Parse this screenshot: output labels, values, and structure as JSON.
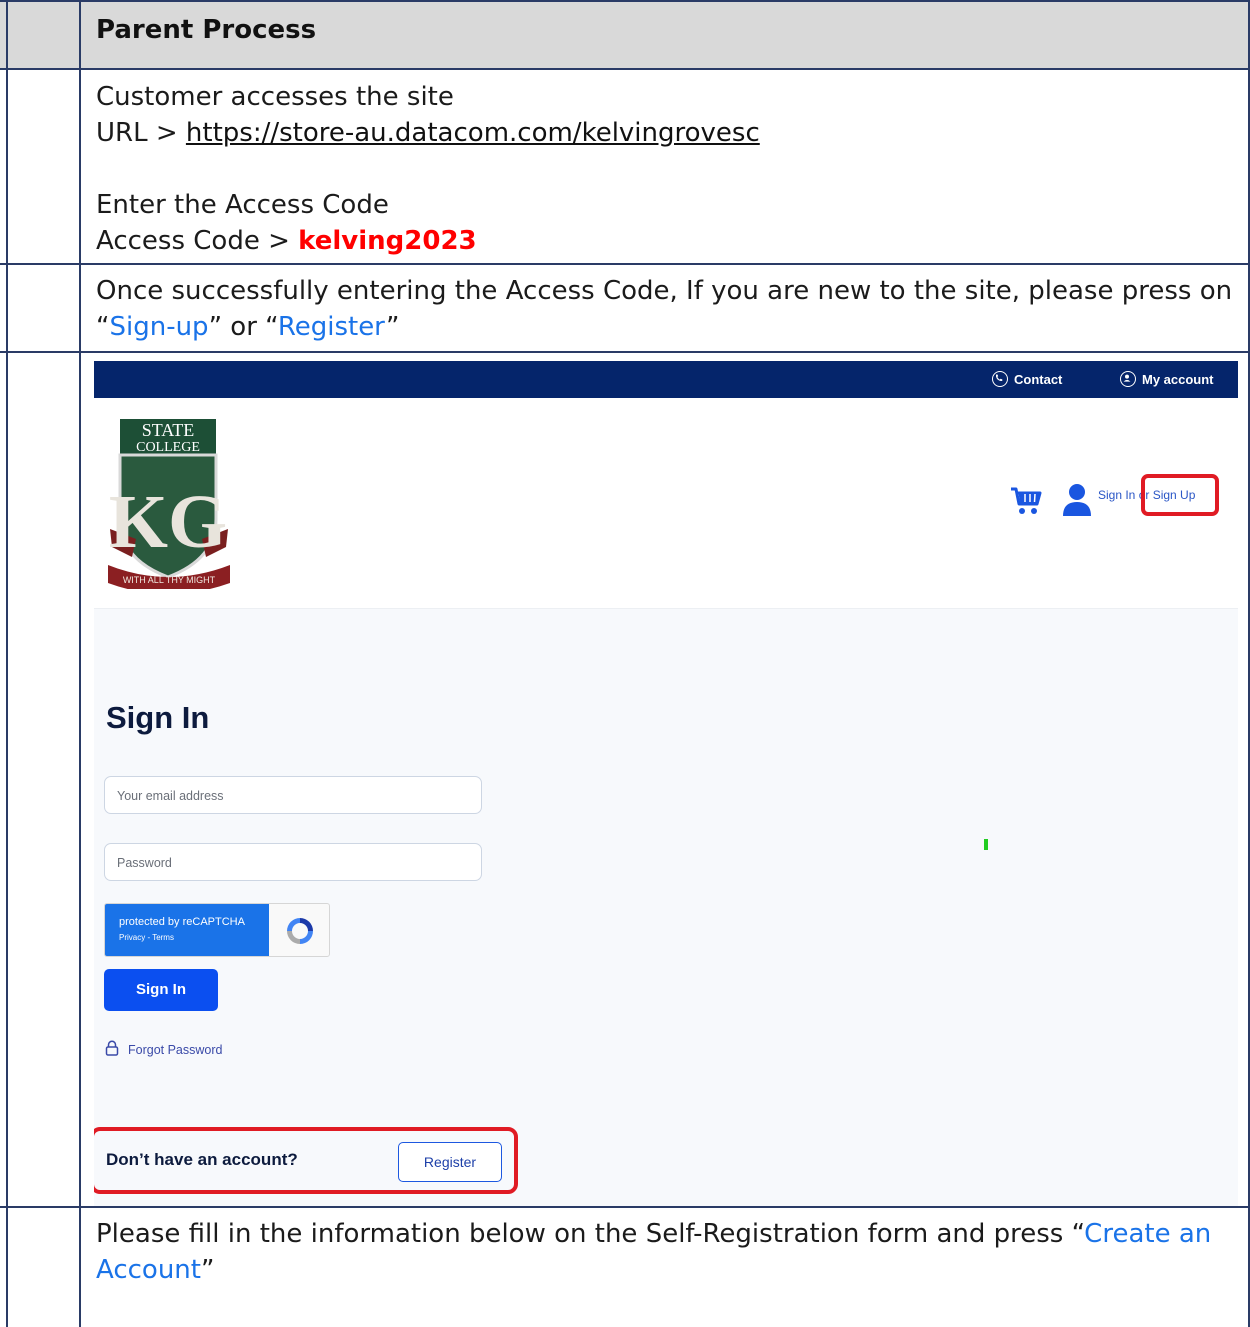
{
  "header": {
    "title": "Parent Process"
  },
  "step1": {
    "line1": "Customer accesses the site",
    "url_prefix": "URL > ",
    "url": "https://store-au.datacom.com/kelvingrovesc",
    "line3": "Enter the Access Code",
    "code_prefix": "Access Code > ",
    "code": "kelving2023"
  },
  "step2": {
    "text_a": "Once successfully entering the Access Code, If you are new to the site, please press on “",
    "link_signup": "Sign-up",
    "text_b": "” or “",
    "link_register": "Register",
    "text_c": "”"
  },
  "screenshot": {
    "topbar": {
      "contact": "Contact",
      "account": "My account"
    },
    "logo": {
      "line1": "STATE",
      "line2": "COLLEGE",
      "monogram": "KG",
      "motto": "WITH ALL THY MIGHT"
    },
    "header_link": "Sign In or Sign Up",
    "signin_title": "Sign In",
    "email_placeholder": "Your email address",
    "password_placeholder": "Password",
    "recaptcha": {
      "line1": "protected by reCAPTCHA",
      "line2": "Privacy - Terms"
    },
    "signin_button": "Sign In",
    "forgot_password": "Forgot Password",
    "no_account": "Don’t have an account?",
    "register_button": "Register",
    "colors": {
      "topbar": "#05256b",
      "accent": "#0b4ff0",
      "highlight": "#e01b24"
    }
  },
  "step3": {
    "text_a": "Please fill in the information below on the Self-Registration form and press “",
    "link": "Create an Account",
    "text_b": "”"
  }
}
